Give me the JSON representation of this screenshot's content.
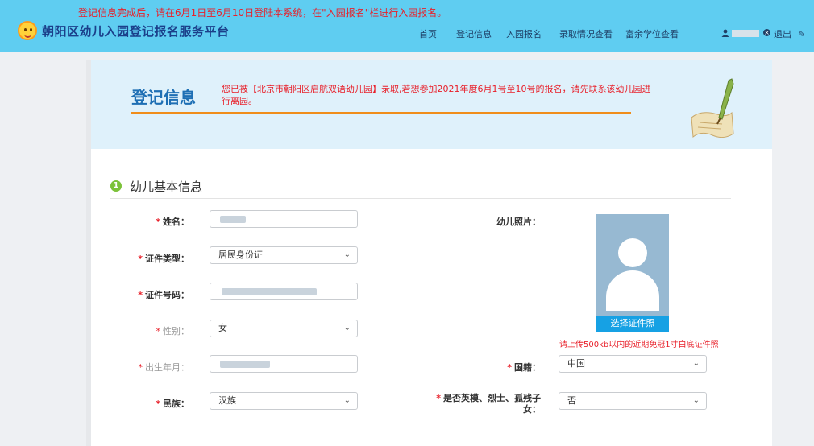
{
  "header": {
    "notice": "登记信息完成后，请在6月1日至6月10日登陆本系统，在\"入园报名\"栏进行入园报名。",
    "title": "朝阳区幼儿入园登记报名服务平台",
    "nav": [
      "首页",
      "登记信息",
      "入园报名",
      "录取情况查看",
      "富余学位查看"
    ],
    "logout": "退出"
  },
  "banner": {
    "title": "登记信息",
    "message": "您已被【北京市朝阳区启航双语幼儿园】录取,若想参加2021年度6月1号至10号的报名，请先联系该幼儿园进行离园。"
  },
  "section": {
    "number": "1",
    "title": "幼儿基本信息"
  },
  "form": {
    "required_mark": "*",
    "name": {
      "label": "姓名：",
      "value": ""
    },
    "id_type": {
      "label": "证件类型：",
      "value": "居民身份证"
    },
    "id_number": {
      "label": "证件号码：",
      "value": ""
    },
    "gender": {
      "label": "性别：",
      "value": "女"
    },
    "birth": {
      "label": "出生年月：",
      "value": ""
    },
    "ethnicity": {
      "label": "民族：",
      "value": "汉族"
    },
    "photo": {
      "label": "幼儿照片：",
      "button": "选择证件照",
      "hint": "请上传500kb以内的近期免冠1寸白底证件照"
    },
    "nationality": {
      "label": "国籍：",
      "value": "中国"
    },
    "martyr": {
      "label_line1": "是否英模、烈士、孤残子",
      "label_line2": "女：",
      "value": "否"
    }
  },
  "icons": {
    "user": "user-icon",
    "logout": "close-circle-icon",
    "edit": "pencil-icon",
    "chevron": "chevron-down-icon"
  }
}
